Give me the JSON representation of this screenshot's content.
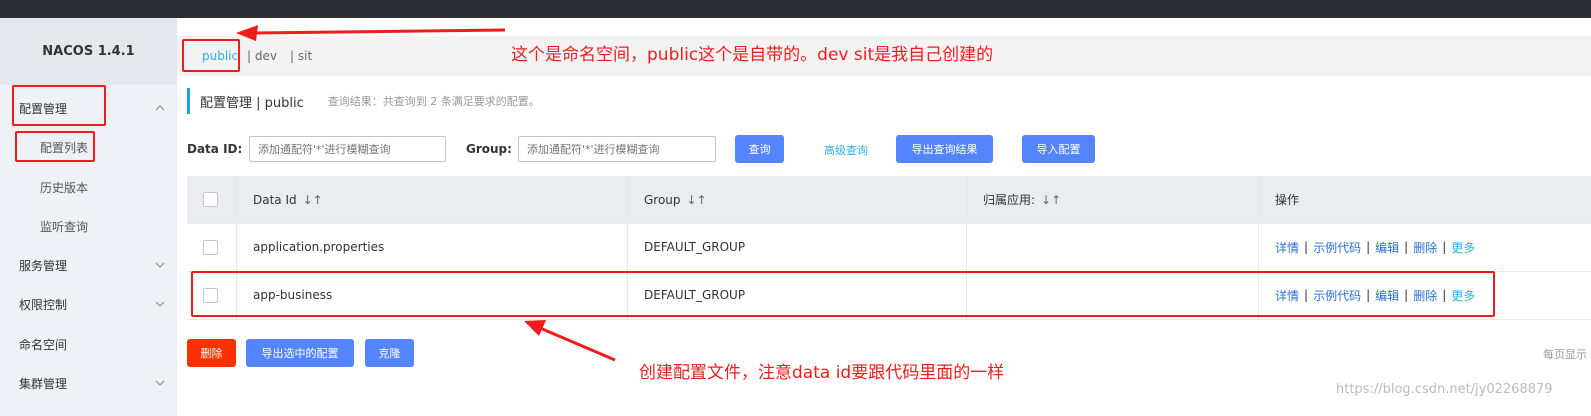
{
  "app": {
    "title": "NACOS 1.4.1"
  },
  "sidebar": {
    "items": [
      {
        "label": "配置管理",
        "expanded": true
      },
      {
        "label": "配置列表",
        "sub": true
      },
      {
        "label": "历史版本",
        "sub": true
      },
      {
        "label": "监听查询",
        "sub": true
      },
      {
        "label": "服务管理"
      },
      {
        "label": "权限控制"
      },
      {
        "label": "命名空间"
      },
      {
        "label": "集群管理"
      }
    ]
  },
  "namespaces": {
    "active": "public",
    "dev": "| dev",
    "sit": "| sit"
  },
  "page": {
    "title": "配置管理  |  public",
    "result_hint": "查询结果：共查询到 2 条满足要求的配置。"
  },
  "search": {
    "dataid_label": "Data ID:",
    "dataid_placeholder": "添加通配符'*'进行模糊查询",
    "group_label": "Group:",
    "group_placeholder": "添加通配符'*'进行模糊查询",
    "query_btn": "查询",
    "advanced_link": "高级查询",
    "export_btn": "导出查询结果",
    "import_btn": "导入配置"
  },
  "table": {
    "headers": [
      "Data Id",
      "Group",
      "归属应用:",
      "操作"
    ],
    "rows": [
      {
        "dataid": "application.properties",
        "group": "DEFAULT_GROUP",
        "app": ""
      },
      {
        "dataid": "app-business",
        "group": "DEFAULT_GROUP",
        "app": ""
      }
    ],
    "ops": {
      "detail": "详情",
      "sample": "示例代码",
      "edit": "编辑",
      "delete": "删除",
      "more": "更多"
    }
  },
  "bulk": {
    "delete": "删除",
    "export_selected": "导出选中的配置",
    "clone": "克隆"
  },
  "pagination": {
    "per_page": "每页显示"
  },
  "annotations": {
    "top": "这个是命名空间，public这个是自带的。dev sit是我自己创建的",
    "bottom": "创建配置文件，注意data id要跟代码里面的一样"
  },
  "watermark": "https://blog.csdn.net/jy02268879",
  "colors": {
    "primary": "#5584ff",
    "danger": "#ff3000",
    "annotation": "#ef1c1c",
    "link": "#2a6fd6"
  }
}
